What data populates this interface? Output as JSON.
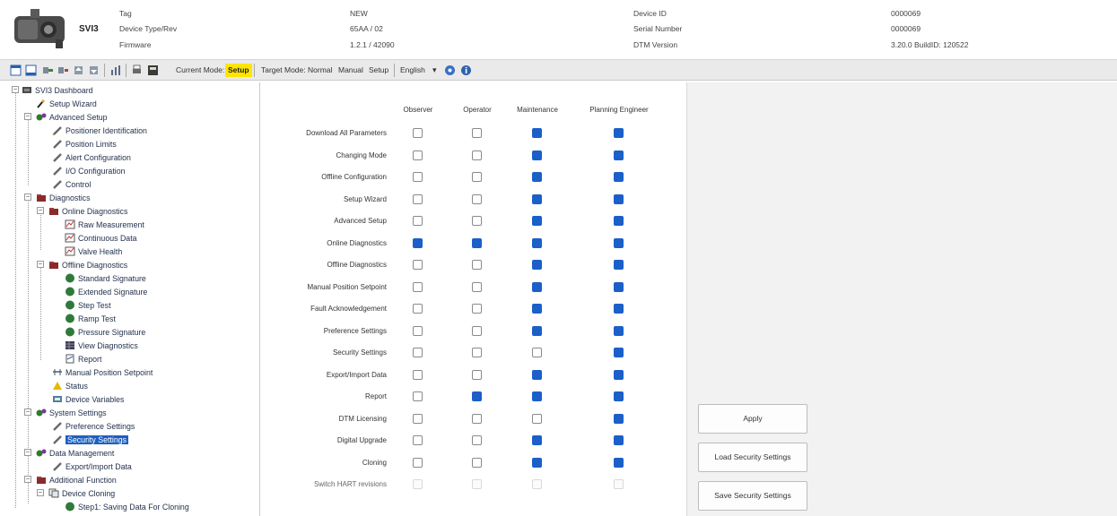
{
  "header": {
    "device_name": "SVI3",
    "fields": [
      {
        "label": "Tag",
        "value": "NEW"
      },
      {
        "label": "Device Type/Rev",
        "value": "65AA / 02"
      },
      {
        "label": "Firmware",
        "value": "1.2.1 / 42090"
      },
      {
        "label": "Device ID",
        "value": "0000069"
      },
      {
        "label": "Serial Number",
        "value": "0000069"
      },
      {
        "label": "DTM Version",
        "value": "3.20.0 BuildID: 120522"
      }
    ]
  },
  "toolbar": {
    "current_mode_label": "Current Mode:",
    "current_mode_value": "Setup",
    "target_mode_label": "Target Mode:",
    "target_modes": [
      "Normal",
      "Manual",
      "Setup"
    ],
    "language": "English",
    "dropdown_glyph": "▾"
  },
  "tree": {
    "nodes": [
      {
        "label": "SVI3 Dashboard"
      },
      {
        "label": "Setup Wizard"
      },
      {
        "label": "Advanced Setup"
      },
      {
        "label": "Positioner Identification"
      },
      {
        "label": "Position Limits"
      },
      {
        "label": "Alert Configuration"
      },
      {
        "label": "I/O Configuration"
      },
      {
        "label": "Control"
      },
      {
        "label": "Diagnostics"
      },
      {
        "label": "Online Diagnostics"
      },
      {
        "label": "Raw Measurement"
      },
      {
        "label": "Continuous Data"
      },
      {
        "label": "Valve Health"
      },
      {
        "label": "Offline Diagnostics"
      },
      {
        "label": "Standard Signature"
      },
      {
        "label": "Extended Signature"
      },
      {
        "label": "Step Test"
      },
      {
        "label": "Ramp Test"
      },
      {
        "label": "Pressure Signature"
      },
      {
        "label": "View Diagnostics"
      },
      {
        "label": "Report"
      },
      {
        "label": "Manual Position Setpoint"
      },
      {
        "label": "Status"
      },
      {
        "label": "Device Variables"
      },
      {
        "label": "System Settings"
      },
      {
        "label": "Preference Settings"
      },
      {
        "label": "Security Settings"
      },
      {
        "label": "Data Management"
      },
      {
        "label": "Export/Import Data"
      },
      {
        "label": "Additional Function"
      },
      {
        "label": "Device Cloning"
      },
      {
        "label": "Step1: Saving Data For Cloning"
      }
    ]
  },
  "permissions": {
    "columns": [
      "Observer",
      "Operator",
      "Maintenance",
      "Planning Engineer"
    ],
    "rows": [
      {
        "label": "Download All Parameters",
        "checks": [
          false,
          false,
          true,
          true
        ]
      },
      {
        "label": "Changing Mode",
        "checks": [
          false,
          false,
          true,
          true
        ]
      },
      {
        "label": "Offline Configuration",
        "checks": [
          false,
          false,
          true,
          true
        ]
      },
      {
        "label": "Setup Wizard",
        "checks": [
          false,
          false,
          true,
          true
        ]
      },
      {
        "label": "Advanced Setup",
        "checks": [
          false,
          false,
          true,
          true
        ]
      },
      {
        "label": "Online Diagnostics",
        "checks": [
          true,
          true,
          true,
          true
        ]
      },
      {
        "label": "Offline Diagnostics",
        "checks": [
          false,
          false,
          true,
          true
        ]
      },
      {
        "label": "Manual Position Setpoint",
        "checks": [
          false,
          false,
          true,
          true
        ]
      },
      {
        "label": "Fault Acknowledgement",
        "checks": [
          false,
          false,
          true,
          true
        ]
      },
      {
        "label": "Preference Settings",
        "checks": [
          false,
          false,
          true,
          true
        ]
      },
      {
        "label": "Security Settings",
        "checks": [
          false,
          false,
          false,
          true
        ]
      },
      {
        "label": "Export/Import Data",
        "checks": [
          false,
          false,
          true,
          true
        ]
      },
      {
        "label": "Report",
        "checks": [
          false,
          true,
          true,
          true
        ]
      },
      {
        "label": "DTM Licensing",
        "checks": [
          false,
          false,
          false,
          true
        ]
      },
      {
        "label": "Digital Upgrade",
        "checks": [
          false,
          false,
          true,
          true
        ]
      },
      {
        "label": "Cloning",
        "checks": [
          false,
          false,
          true,
          true
        ]
      },
      {
        "label": "Switch HART revisions",
        "checks": [
          false,
          false,
          false,
          false
        ],
        "disabled": true
      }
    ]
  },
  "buttons": {
    "apply": "Apply",
    "load": "Load Security Settings",
    "save": "Save Security Settings"
  },
  "colors": {
    "accent": "#1b5fc9",
    "mode_highlight": "#ffe600",
    "tree_selection": "#1f5fbf",
    "right_panel": "#f2f2f2"
  }
}
